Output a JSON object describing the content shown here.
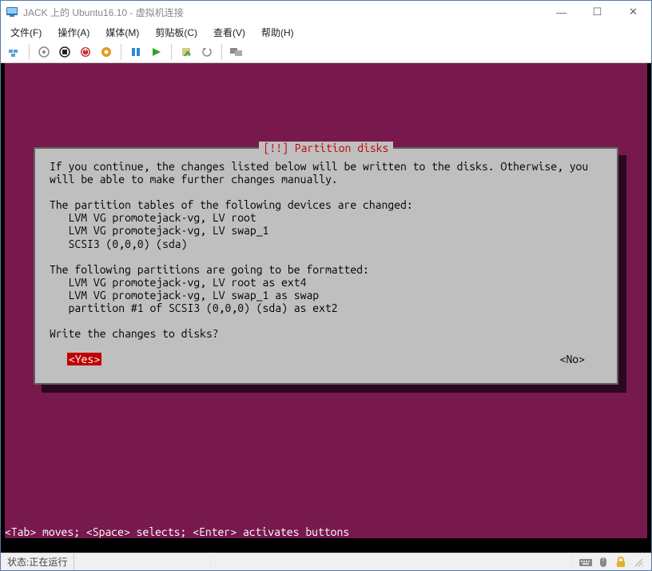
{
  "window": {
    "title": "JACK 上的 Ubuntu16.10 - 虚拟机连接",
    "controls": {
      "min": "—",
      "max": "☐",
      "close": "✕"
    }
  },
  "menubar": {
    "file": "文件(F)",
    "action": "操作(A)",
    "media": "媒体(M)",
    "clipboard": "剪贴板(C)",
    "view": "查看(V)",
    "help": "帮助(H)"
  },
  "installer": {
    "title_prefix": "[!!] ",
    "title": "Partition disks",
    "body_line_1": "If you continue, the changes listed below will be written to the disks. Otherwise, you",
    "body_line_2": "will be able to make further changes manually.",
    "body_line_3": "",
    "body_line_4": "The partition tables of the following devices are changed:",
    "body_line_5": "   LVM VG promotejack-vg, LV root",
    "body_line_6": "   LVM VG promotejack-vg, LV swap_1",
    "body_line_7": "   SCSI3 (0,0,0) (sda)",
    "body_line_8": "",
    "body_line_9": "The following partitions are going to be formatted:",
    "body_line_10": "   LVM VG promotejack-vg, LV root as ext4",
    "body_line_11": "   LVM VG promotejack-vg, LV swap_1 as swap",
    "body_line_12": "   partition #1 of SCSI3 (0,0,0) (sda) as ext2",
    "body_line_13": "",
    "body_line_14": "Write the changes to disks?",
    "yes": "<Yes>",
    "no": "<No>",
    "hint": "<Tab> moves; <Space> selects; <Enter> activates buttons"
  },
  "statusbar": {
    "state_label": "状态: ",
    "state_value": "正在运行"
  }
}
